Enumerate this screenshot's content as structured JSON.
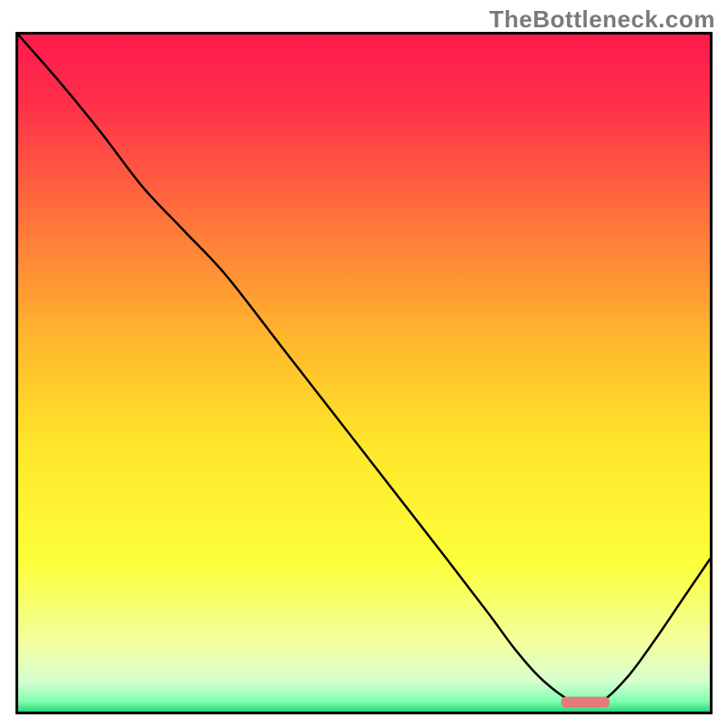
{
  "watermark": "TheBottleneck.com",
  "chart_data": {
    "type": "line",
    "title": "",
    "xlabel": "",
    "ylabel": "",
    "xlim": [
      0,
      100
    ],
    "ylim": [
      0,
      100
    ],
    "grid": false,
    "legend": false,
    "background_gradient": {
      "stops": [
        {
          "pos": 0.0,
          "color": "#ff1a4d"
        },
        {
          "pos": 0.1,
          "color": "#ff2f4a"
        },
        {
          "pos": 0.25,
          "color": "#ff6a3d"
        },
        {
          "pos": 0.45,
          "color": "#ffb72d"
        },
        {
          "pos": 0.6,
          "color": "#ffe52a"
        },
        {
          "pos": 0.78,
          "color": "#fcff3a"
        },
        {
          "pos": 0.9,
          "color": "#f2ffa0"
        },
        {
          "pos": 0.955,
          "color": "#d6ffd0"
        },
        {
          "pos": 0.985,
          "color": "#7fffb0"
        },
        {
          "pos": 1.0,
          "color": "#2dd47a"
        }
      ]
    },
    "series": [
      {
        "name": "bottleneck-curve",
        "x": [
          0.0,
          6.0,
          12.0,
          18.0,
          24.0,
          30.0,
          38.0,
          46.0,
          54.0,
          62.0,
          68.0,
          72.0,
          76.0,
          80.5,
          84.0,
          88.0,
          92.0,
          96.0,
          100.0
        ],
        "y": [
          100.0,
          93.0,
          85.5,
          77.5,
          71.0,
          64.5,
          54.0,
          43.5,
          33.0,
          22.5,
          14.5,
          9.0,
          4.5,
          1.3,
          1.3,
          5.0,
          10.5,
          16.5,
          22.5
        ]
      }
    ],
    "marker": {
      "name": "optimal-marker",
      "x_center": 82.0,
      "y_center": 1.4,
      "width": 7.0,
      "height": 1.6,
      "color": "#e47a7a"
    }
  }
}
